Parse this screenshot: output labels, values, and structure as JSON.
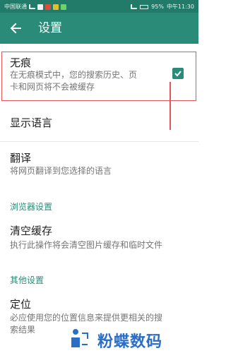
{
  "statusbar": {
    "carrier": "中国联通",
    "battery": "95%",
    "time": "中午11:30"
  },
  "toolbar": {
    "title": "设置"
  },
  "incognito": {
    "title": "无痕",
    "description_line1": "在无痕模式中，您的搜索历史、页",
    "description_line2": "卡和网页将不会被缓存",
    "checked": true
  },
  "language": {
    "title": "显示语言"
  },
  "translate": {
    "title": "翻译",
    "description": "将网页翻译到您选择的语言"
  },
  "browser_section": {
    "header": "浏览器设置"
  },
  "clear_cache": {
    "title": "清空缓存",
    "description": "执行此操作将会清空图片缓存和临时文件"
  },
  "other_section": {
    "header": "其他设置"
  },
  "location": {
    "title": "定位",
    "description_line1": "必应使用您的位置信息来提供更相关的搜",
    "description_line2": "索结果"
  },
  "watermark": {
    "text": "粉蝶数码"
  },
  "colors": {
    "primary": "#2a8c78",
    "statusbar": "#227a68",
    "annotation": "#e2555a",
    "section": "#2a8c78"
  }
}
